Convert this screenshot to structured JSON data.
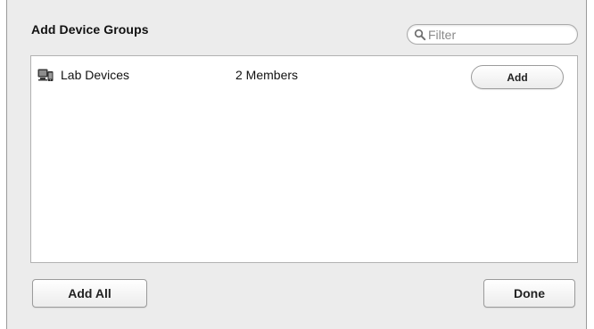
{
  "dialog": {
    "title": "Add Device Groups",
    "filter": {
      "placeholder": "Filter",
      "value": "",
      "icon": "magnifier-icon"
    }
  },
  "groups": [
    {
      "icon": "device-group-icon",
      "name": "Lab Devices",
      "members": "2 Members",
      "add_label": "Add"
    }
  ],
  "footer": {
    "add_all_label": "Add All",
    "done_label": "Done"
  }
}
